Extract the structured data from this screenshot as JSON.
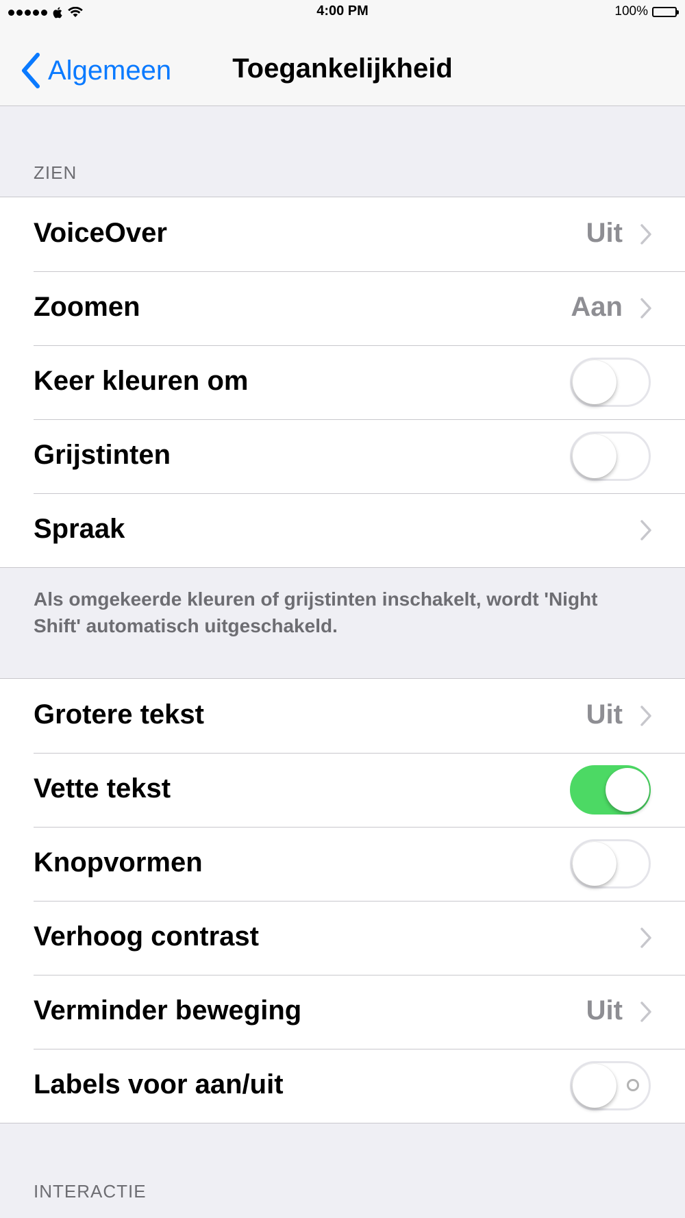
{
  "status_bar": {
    "time": "4:00 PM",
    "battery_percent": "100%",
    "signal_icon": "signal-dots-icon",
    "carrier_icon": "apple-logo-icon",
    "wifi_icon": "wifi-icon",
    "battery_icon": "battery-icon"
  },
  "nav": {
    "back_label": "Algemeen",
    "title": "Toegankelijkheid"
  },
  "sections": {
    "zien_header": "ZIEN",
    "zien_rows": [
      {
        "label": "VoiceOver",
        "value": "Uit",
        "type": "disclosure"
      },
      {
        "label": "Zoomen",
        "value": "Aan",
        "type": "disclosure"
      },
      {
        "label": "Keer kleuren om",
        "type": "toggle",
        "on": false
      },
      {
        "label": "Grijstinten",
        "type": "toggle",
        "on": false
      },
      {
        "label": "Spraak",
        "type": "disclosure"
      }
    ],
    "zien_footer": "Als omgekeerde kleuren of grijstinten inschakelt, wordt 'Night Shift' automatisch uitgeschakeld.",
    "text_rows": [
      {
        "label": "Grotere tekst",
        "value": "Uit",
        "type": "disclosure"
      },
      {
        "label": "Vette tekst",
        "type": "toggle",
        "on": true
      },
      {
        "label": "Knopvormen",
        "type": "toggle",
        "on": false
      },
      {
        "label": "Verhoog contrast",
        "type": "disclosure"
      },
      {
        "label": "Verminder beweging",
        "value": "Uit",
        "type": "disclosure"
      },
      {
        "label": "Labels voor aan/uit",
        "type": "toggle",
        "on": false
      }
    ],
    "interactie_header": "INTERACTIE"
  },
  "colors": {
    "accent": "#0a7aff",
    "toggle_on": "#4cd964",
    "background": "#efeff4",
    "secondary_text": "#8e8e93"
  }
}
